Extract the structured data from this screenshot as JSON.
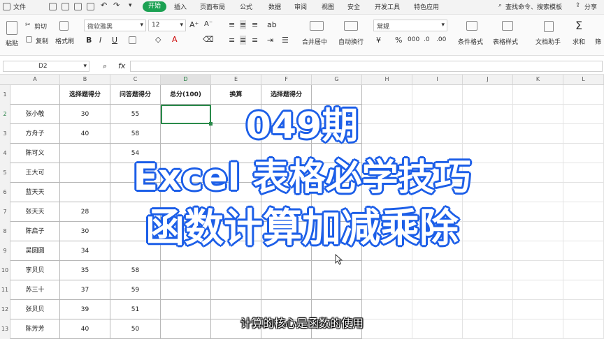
{
  "menu": {
    "file": "文件",
    "start": "开始",
    "insert": "插入",
    "page_layout": "页面布局",
    "formula": "公式",
    "data": "数据",
    "review": "审阅",
    "view": "视图",
    "security": "安全",
    "dev_tools": "开发工具",
    "special_apps": "特色应用",
    "search": "查找命令、搜索模板",
    "share": "分享"
  },
  "ribbon": {
    "paste": "粘贴",
    "cut": "剪切",
    "copy": "复制",
    "format_painter": "格式刷",
    "font_name": "微软雅黑",
    "font_size": "12",
    "bold": "B",
    "italic": "I",
    "underline": "U",
    "merge_center": "合并居中",
    "wrap_text": "自动换行",
    "number_format": "常规",
    "percent": "%",
    "conditional_format": "条件格式",
    "table_style": "表格样式",
    "doc_assistant": "文档助手",
    "sum": "求和",
    "filter": "筛"
  },
  "formula_bar": {
    "cell_ref": "D2",
    "fx": "fx"
  },
  "sheet": {
    "columns": [
      "A",
      "B",
      "C",
      "D",
      "E",
      "F",
      "G",
      "H",
      "I",
      "J",
      "K",
      "L"
    ],
    "rows": [
      "1",
      "2",
      "3",
      "4",
      "5",
      "6",
      "7",
      "8",
      "9",
      "10",
      "11",
      "12",
      "13"
    ],
    "headers": [
      "选择题得分",
      "问答题得分",
      "总分(100)",
      "换算",
      "选择题得分",
      ""
    ],
    "names": [
      "张小敬",
      "方舟子",
      "陈可义",
      "王大可",
      "蓝天天",
      "张天天",
      "陈启子",
      "吴圆圆",
      "李贝贝",
      "苏三十",
      "张贝贝",
      "陈芳芳"
    ],
    "choice": [
      "30",
      "40",
      "",
      "",
      "",
      "28",
      "30",
      "34",
      "35",
      "37",
      "39",
      "40"
    ],
    "qa": [
      "55",
      "58",
      "54",
      "",
      "",
      "",
      "",
      "",
      "58",
      "59",
      "51",
      "50"
    ]
  },
  "overlay": {
    "line1": "049期",
    "line2": "Excel 表格必学技巧",
    "line3": "函数计算加减乘除",
    "subtitle": "计算的核心是函数的使用"
  }
}
